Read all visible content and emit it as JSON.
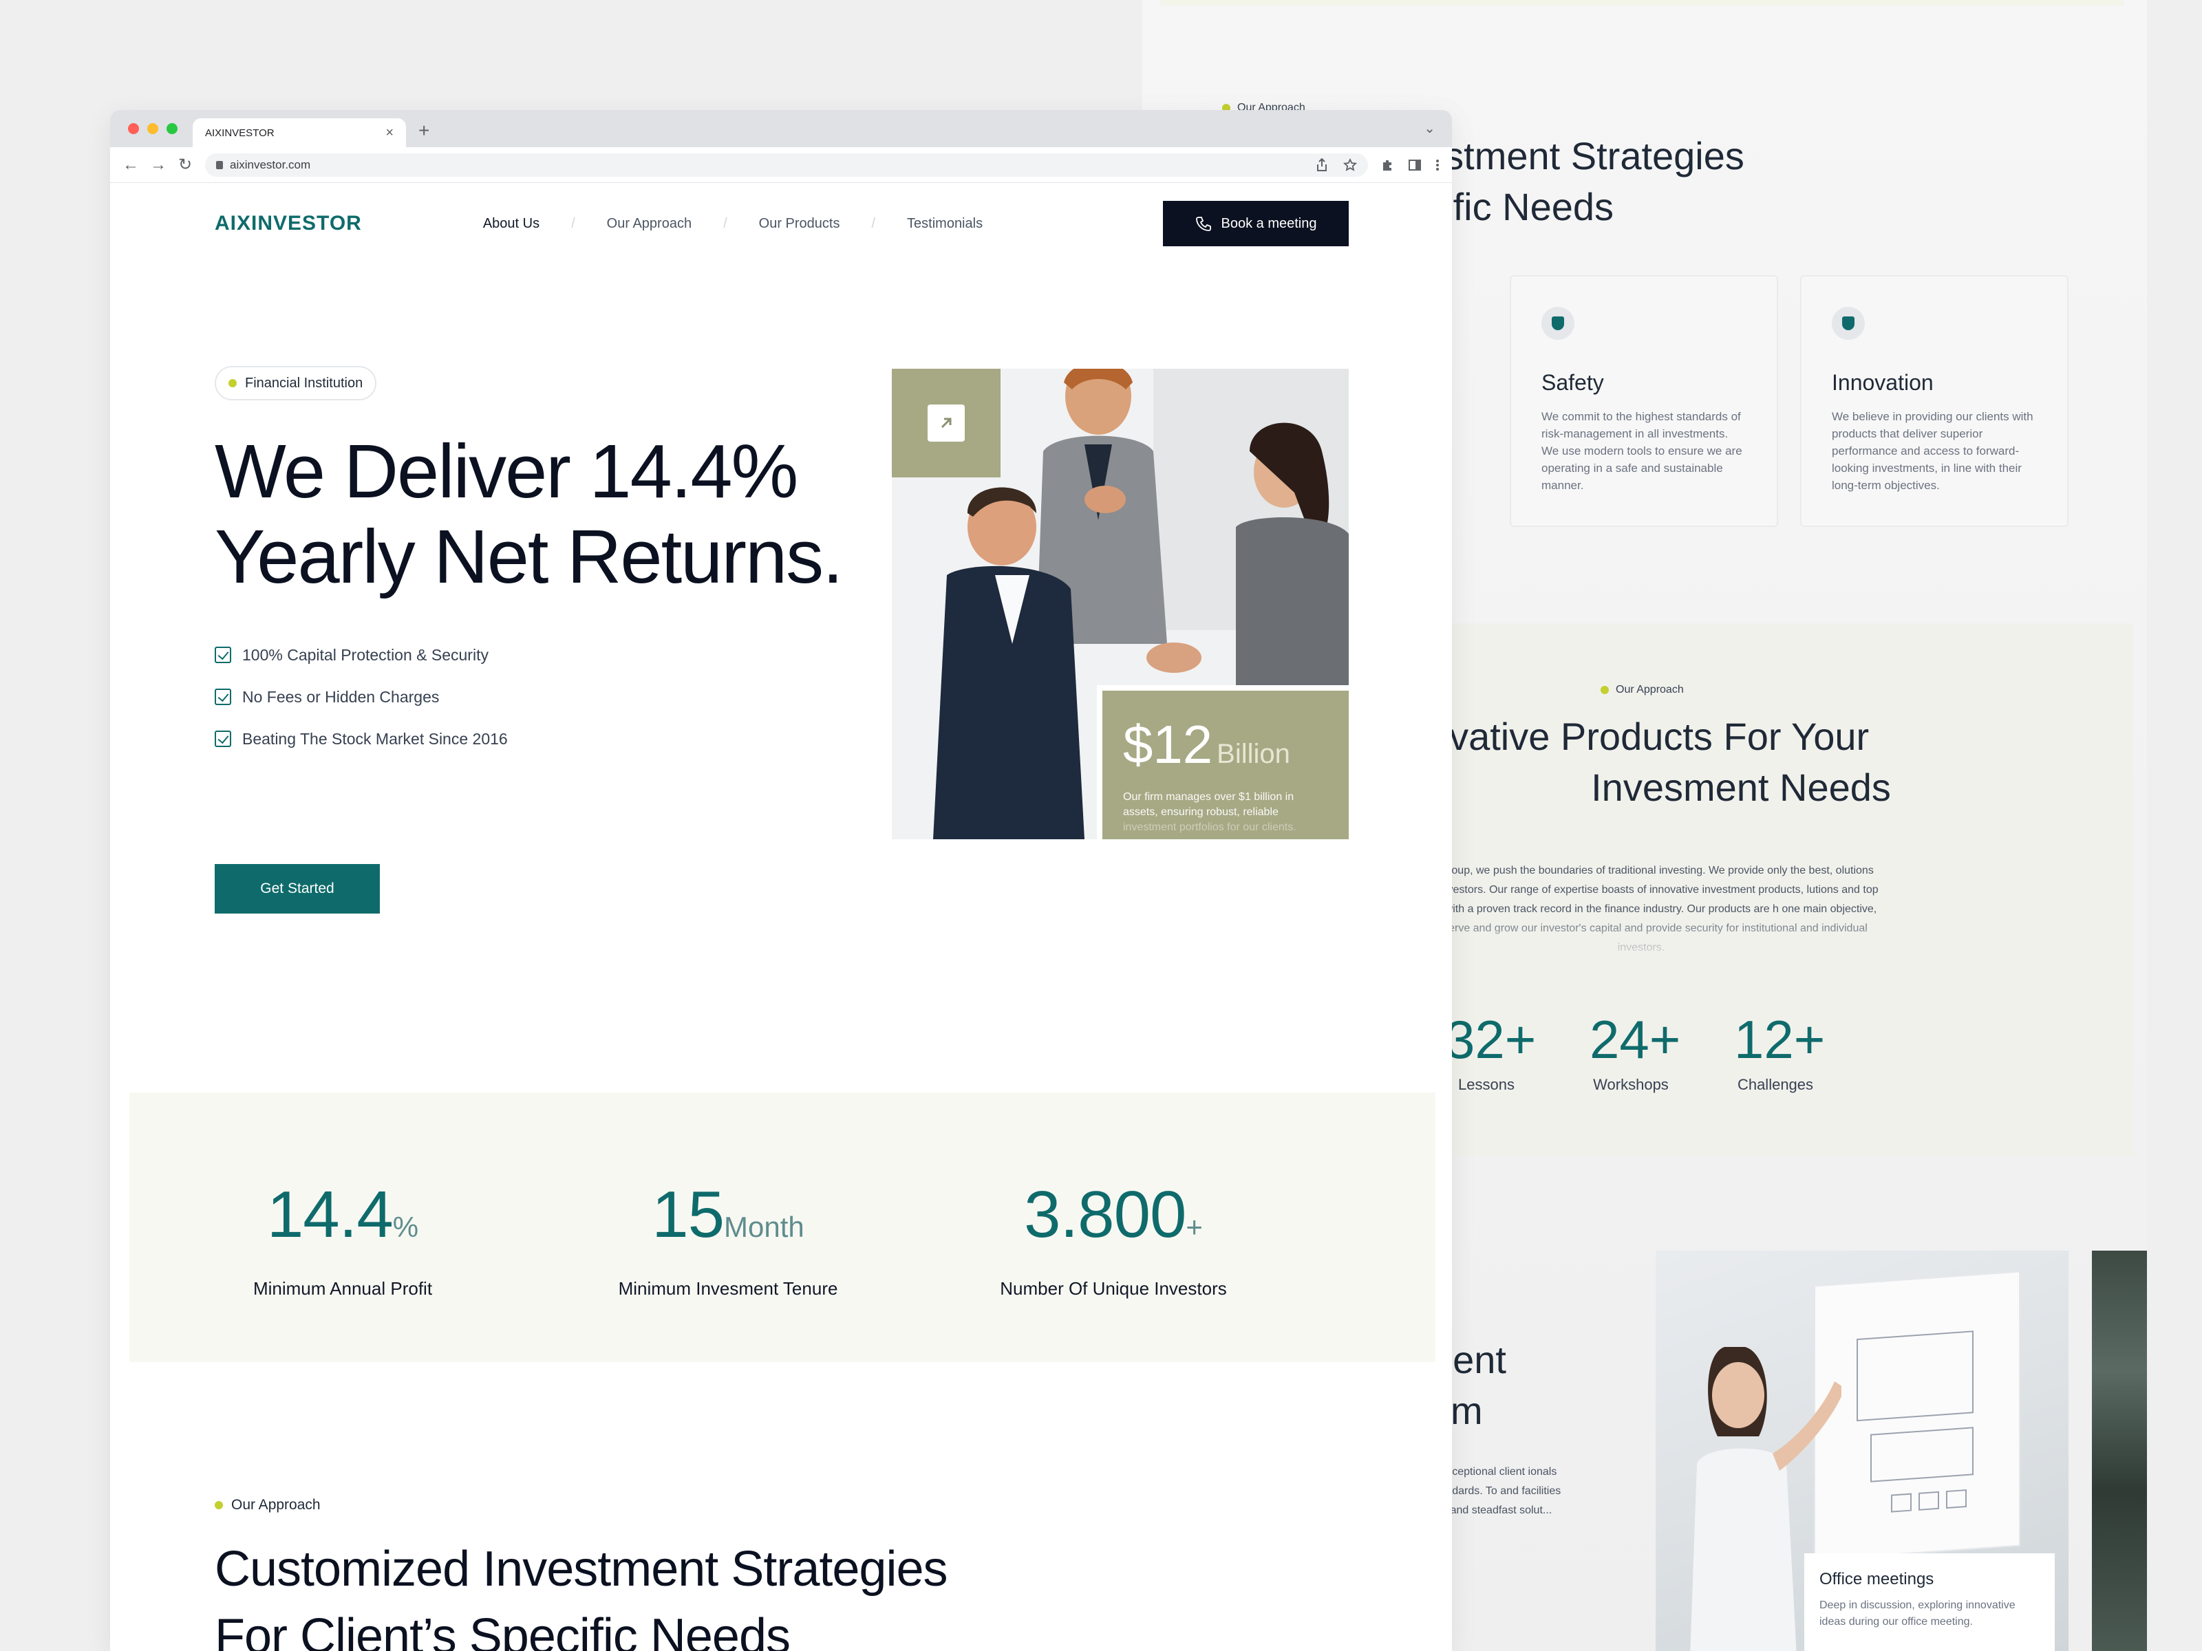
{
  "colors": {
    "brand": "#0f6b6b",
    "olive": "#a6a984",
    "dark": "#0b1120",
    "accent_dot": "#c3d02f",
    "stats_bg": "#f8f8f3"
  },
  "background_page": {
    "top_tag": "Our Approach",
    "heading_lines": [
      "vestment Strategies",
      "ecific Needs"
    ],
    "cards": [
      {
        "icon": "shield-icon",
        "title": "Safety",
        "text": "We commit to the highest standards of risk-management in all investments. We use modern tools to ensure we are operating in a safe and sustainable manner."
      },
      {
        "icon": "shield-icon",
        "title": "Innovation",
        "text": "We believe in providing our clients with products that deliver superior performance and access to forward-looking investments, in line with their long-term objectives."
      }
    ],
    "approach": {
      "tag": "Our Approach",
      "heading_lines": [
        "novative Products For Your",
        "Invesment Needs"
      ],
      "paragraph": "tment Group, we push the boundaries of traditional investing. We provide only the best, olutions for our investors. Our range of expertise boasts of innovative investment products, lutions and top experts with a proven track record in the finance industry. Our products are h one main objective, to preserve and grow our investor's capital and provide security for institutional and individual investors.",
      "stats": [
        {
          "num": "32+",
          "label": "Lessons"
        },
        {
          "num": "24+",
          "label": "Workshops"
        },
        {
          "num": "12+",
          "label": "Challenges"
        }
      ]
    },
    "heading3_lines": [
      "nent",
      "sm"
    ],
    "para3": "e exceptional client ionals standards. To and facilities are and steadfast solut...",
    "office_card": {
      "title": "Office meetings",
      "text": "Deep in discussion, exploring innovative ideas during our office meeting."
    }
  },
  "browser": {
    "tab_title": "AIXINVESTOR",
    "url": "aixinvestor.com",
    "close_glyph": "×",
    "new_tab_glyph": "+",
    "chevron_glyph": "⌄",
    "back_glyph": "←",
    "forward_glyph": "→",
    "reload_glyph": "↻"
  },
  "site": {
    "logo": "AIXINVESTOR",
    "nav": [
      {
        "label": "About Us",
        "active": true
      },
      {
        "label": "Our Approach",
        "active": false
      },
      {
        "label": "Our Products",
        "active": false
      },
      {
        "label": "Testimonials",
        "active": false
      }
    ],
    "nav_separator": "/",
    "book_button": "Book a meeting",
    "badge": "Financial Institution",
    "hero_title_lines": [
      "We Deliver 14.4%",
      "Yearly Net Returns."
    ],
    "checks": [
      "100% Capital Protection & Security",
      "No Fees or Hidden Charges",
      "Beating The Stock Market Since 2016"
    ],
    "cta": "Get Started",
    "money": {
      "amount": "$12",
      "unit": "Billion",
      "text": "Our firm manages over $1 billion in assets, ensuring robust, reliable",
      "text_faded": "investment portfolios for our clients."
    },
    "stats": [
      {
        "num": "14.4",
        "suffix": "%",
        "label": "Minimum Annual Profit"
      },
      {
        "num": "15",
        "suffix": "Month",
        "label": "Minimum Invesment Tenure"
      },
      {
        "num": "3.800",
        "suffix": "+",
        "label": "Number Of Unique Investors"
      }
    ],
    "approach": {
      "tag": "Our Approach",
      "title_lines": [
        "Customized Investment Strategies",
        "For Client’s Specific Needs"
      ]
    }
  }
}
